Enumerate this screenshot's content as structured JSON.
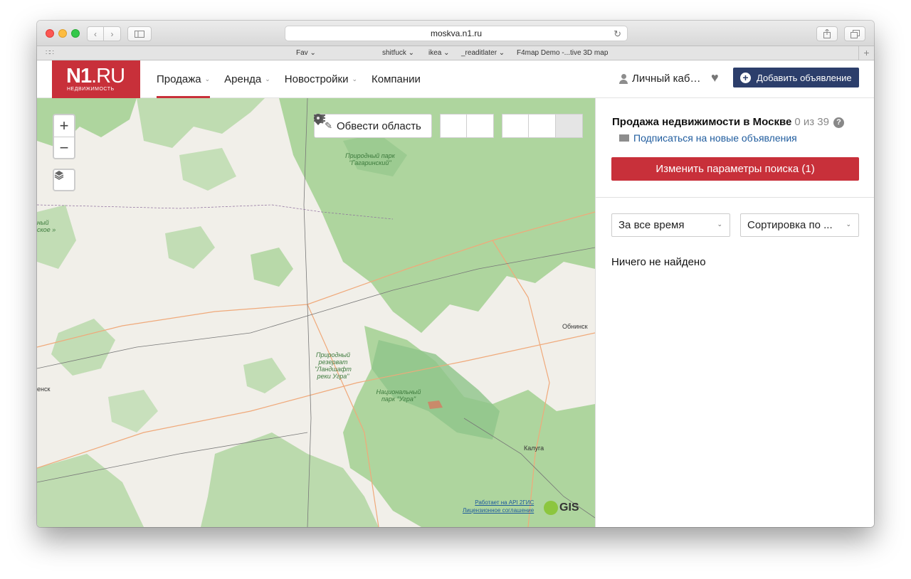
{
  "browser": {
    "url": "moskva.n1.ru",
    "bookmarks": [
      "Fav ⌄",
      "shitfuck ⌄",
      "ikea ⌄",
      "_readitlater ⌄",
      "F4map Demo -...tive 3D map"
    ]
  },
  "header": {
    "logo_main": "N1",
    "logo_ru": ".RU",
    "logo_sub": "НЕДВИЖИМОСТЬ",
    "nav": [
      {
        "label": "Продажа",
        "has_menu": true
      },
      {
        "label": "Аренда",
        "has_menu": true
      },
      {
        "label": "Новостройки",
        "has_menu": true
      },
      {
        "label": "Компании",
        "has_menu": false
      }
    ],
    "cabinet": "Личный каб…",
    "add_button": "Добавить объявление"
  },
  "map": {
    "draw_area": "Обвести область",
    "zoom_in": "+",
    "zoom_out": "−",
    "labels": {
      "park_gagarin": "Природный парк \"Гагаринский\"",
      "reserve": "Природный резерват \"Ландшафт реки Угра\"",
      "national_park": "Национальный парк \"Угра\"",
      "edge_left": "ный ское »",
      "edge_city": "енск"
    },
    "cities": {
      "obninsk": "Обнинск",
      "kaluga": "Калуга"
    },
    "attribution_api": "Работает на API 2ГИС",
    "attribution_license": "Лицензионное соглашение",
    "gis": "GIS"
  },
  "panel": {
    "title": "Продажа недвижимости в Москве",
    "count": "0 из 39",
    "help": "?",
    "subscribe": "Подписаться на новые объявления",
    "change_search": "Изменить параметры поиска (1)",
    "period_select": "За все время",
    "sort_select": "Сортировка по ...",
    "empty": "Ничего не найдено"
  },
  "colors": {
    "brand_red": "#c8303a",
    "dark_blue": "#2c3e6b",
    "link_blue": "#1f5c9e",
    "forest": "#a9d39b",
    "map_bg": "#f1efe9"
  }
}
